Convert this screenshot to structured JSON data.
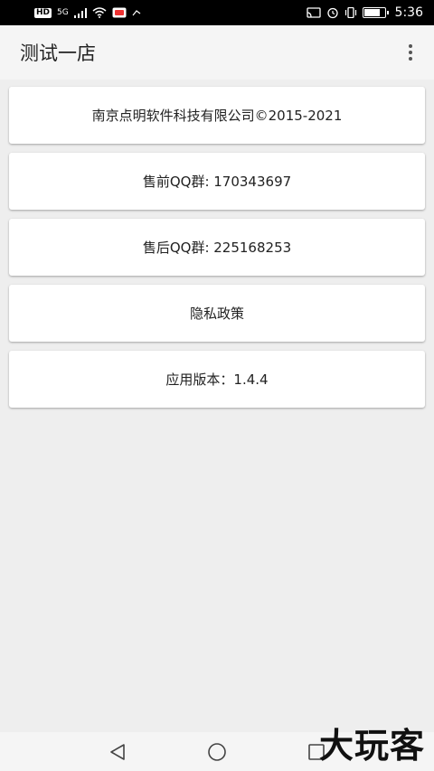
{
  "status_bar": {
    "hd_badge": "HD",
    "network": "5G",
    "time": "5:36"
  },
  "app_bar": {
    "title": "测试一店"
  },
  "cards": [
    {
      "text": "南京点明软件科技有限公司©2015-2021"
    },
    {
      "text": "售前QQ群: 170343697"
    },
    {
      "text": "售后QQ群: 225168253"
    },
    {
      "text": "隐私政策"
    },
    {
      "text": "应用版本：1.4.4"
    }
  ],
  "watermark": "大玩客",
  "icons": [
    "wifi-icon",
    "signal-icon",
    "cast-icon",
    "alarm-icon",
    "vibrate-icon",
    "battery-icon",
    "overflow-menu-icon",
    "nav-back-icon",
    "nav-home-icon",
    "nav-recents-icon"
  ]
}
